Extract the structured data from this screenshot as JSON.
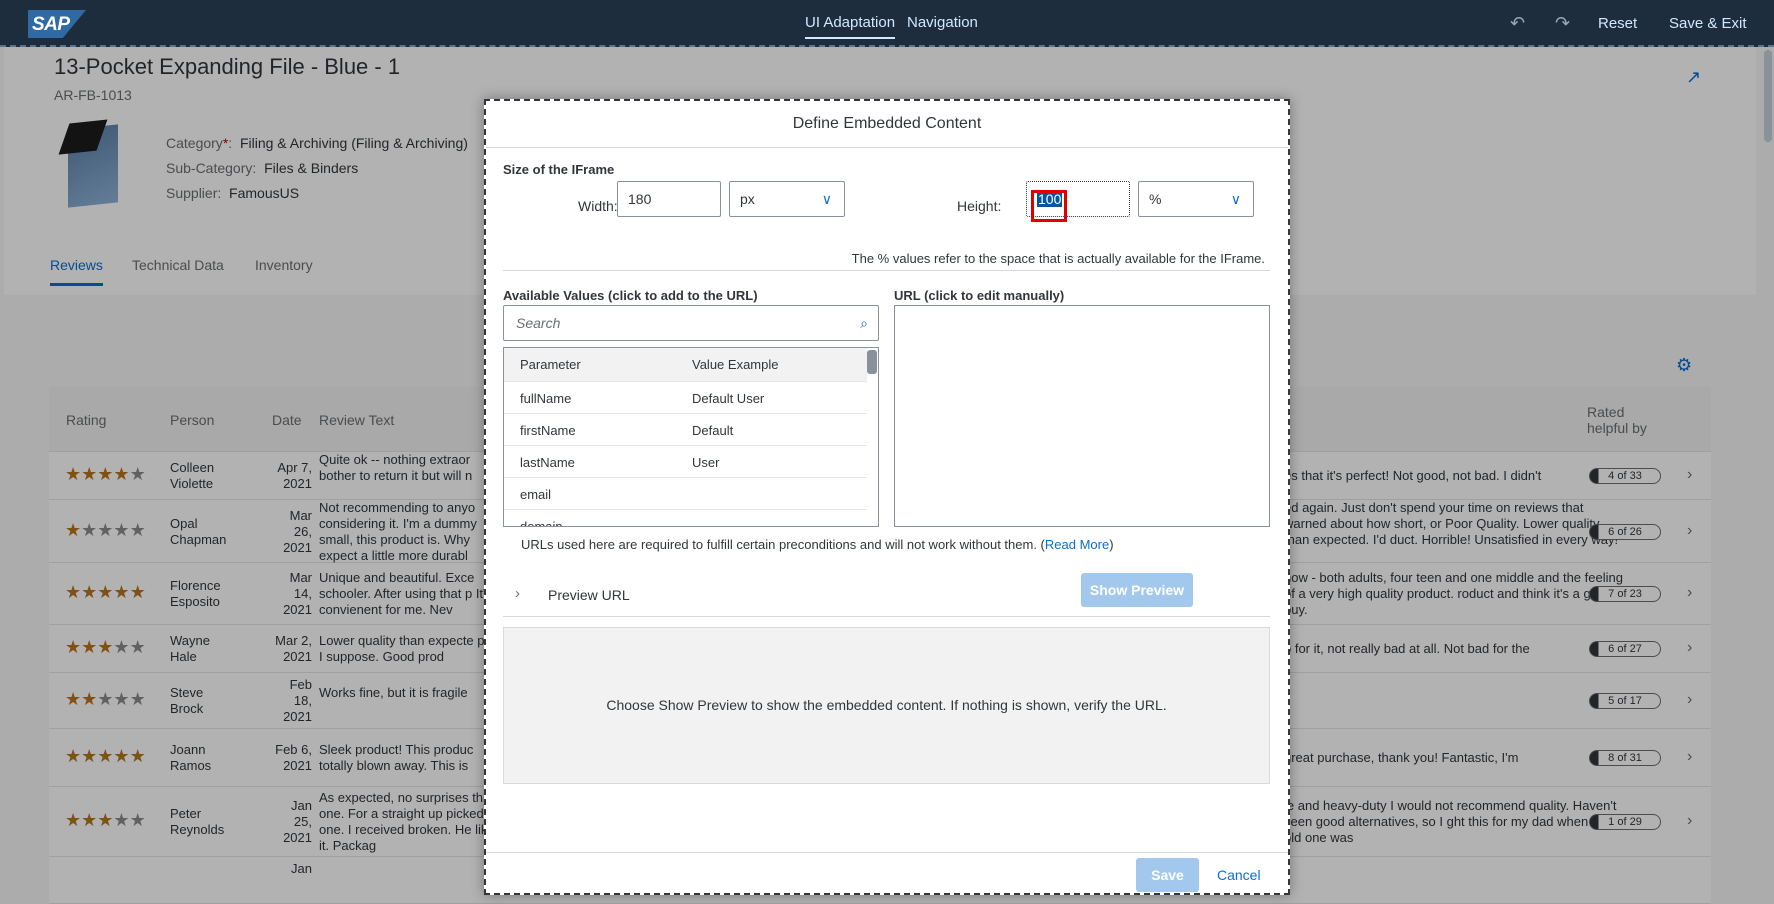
{
  "shell": {
    "logo": "SAP",
    "tabs": [
      "UI Adaptation",
      "Navigation"
    ],
    "reset": "Reset",
    "save_exit": "Save & Exit"
  },
  "object": {
    "title": "13-Pocket Expanding File - Blue - 1",
    "id": "AR-FB-1013",
    "category_label": "Category",
    "category_required": "*",
    "category_sep": ":",
    "category_value": "Filing & Archiving (Filing & Archiving)",
    "subcategory_label": "Sub-Category:",
    "subcategory_value": "Files & Binders",
    "supplier_label": "Supplier:",
    "supplier_value": "FamousUS",
    "tabs": [
      "Reviews",
      "Technical Data",
      "Inventory"
    ]
  },
  "reviews": {
    "headers": {
      "rating": "Rating",
      "person": "Person",
      "date": "Date",
      "text": "Review Text",
      "helpful_1": "Rated",
      "helpful_2": "helpful by"
    },
    "rows": [
      {
        "rating": 4,
        "person_1": "Colleen",
        "person_2": "Violette",
        "date_1": "Apr 7,",
        "date_2": "2021",
        "date_3": "",
        "text_l": "Quite ok -- nothing extraor bother to return it but will n",
        "text_r": "es that it's perfect! Not good, not bad. I didn't",
        "helpful": "4 of 33"
      },
      {
        "rating": 1,
        "person_1": "Opal",
        "person_2": "Chapman",
        "date_1": "Mar",
        "date_2": "26,",
        "date_3": "2021",
        "text_l": "Not recommending to anyo considering it. I'm a dummy small, this product is. Why expect a little more durabl",
        "text_r": "ed again. Just don't spend your time on reviews that warned about how short, or Poor Quality. Lower quality than expected. I'd duct. Horrible! Unsatisfied in every way!",
        "helpful": "6 of 26"
      },
      {
        "rating": 5,
        "person_1": "Florence",
        "person_2": "Esposito",
        "date_1": "Mar",
        "date_2": "14,",
        "date_3": "2021",
        "text_l": "Unique and beautiful. Exce schooler. After using that p It's convienent for me. Nev",
        "text_r": "how - both adults, four teen and one middle and the feeling of a very high quality product. roduct and think it's a good buy.",
        "helpful": "7 of 23"
      },
      {
        "rating": 3,
        "person_1": "Wayne",
        "person_2": "Hale",
        "date_1": "Mar 2,",
        "date_2": "2021",
        "date_3": "",
        "text_l": "Lower quality than expecte price I suppose. Good prod",
        "text_r": "o for it, not really bad at all. Not bad for the",
        "helpful": "6 of 27"
      },
      {
        "rating": 2,
        "person_1": "Steve",
        "person_2": "Brock",
        "date_1": "Feb",
        "date_2": "18,",
        "date_3": "2021",
        "text_l": "Works fine, but it is fragile",
        "text_r": "",
        "helpful": "5 of 17"
      },
      {
        "rating": 5,
        "person_1": "Joann",
        "person_2": "Ramos",
        "date_1": "Feb 6,",
        "date_2": "2021",
        "date_3": "",
        "text_l": "Sleek product! This produc totally blown away. This is",
        "text_r": "great purchase, thank you! Fantastic, I'm",
        "helpful": "8 of 31"
      },
      {
        "rating": 3,
        "person_1": "Peter",
        "person_2": "Reynolds",
        "date_1": "Jan",
        "date_2": "25,",
        "date_3": "2021",
        "text_l": "As expected, no surprises this one. For a straight up picked this one. I received broken. He likes it. Packag",
        "text_r": "le and heavy-duty I would not recommend quality. Haven't seen good alternatives, so I ght this for my dad when the old one was",
        "helpful": "1 of 29"
      }
    ],
    "last_row_date": "Jan"
  },
  "dialog": {
    "title": "Define Embedded Content",
    "size_section": "Size of the IFrame",
    "width_label": "Width:",
    "width_value": "180",
    "width_unit": "px",
    "height_label": "Height:",
    "height_value": "100",
    "height_unit": "%",
    "percent_hint": "The % values refer to the space that is actually available for the IFrame.",
    "available_label": "Available Values (click to add to the URL)",
    "url_label": "URL (click to edit manually)",
    "search_placeholder": "Search",
    "param_header": "Parameter",
    "value_header": "Value Example",
    "params": [
      {
        "name": "fullName",
        "value": "Default User"
      },
      {
        "name": "firstName",
        "value": "Default"
      },
      {
        "name": "lastName",
        "value": "User"
      },
      {
        "name": "email",
        "value": ""
      },
      {
        "name": "domain",
        "value": ""
      }
    ],
    "url_note_prefix": "URLs used here are required to fulfill certain preconditions and will not work without them. (",
    "read_more": "Read More",
    "url_note_suffix": ")",
    "preview_url_label": "Preview URL",
    "show_preview": "Show Preview",
    "preview_placeholder": "Choose Show Preview to show the embedded content. If nothing is shown, verify the URL.",
    "save": "Save",
    "cancel": "Cancel"
  }
}
